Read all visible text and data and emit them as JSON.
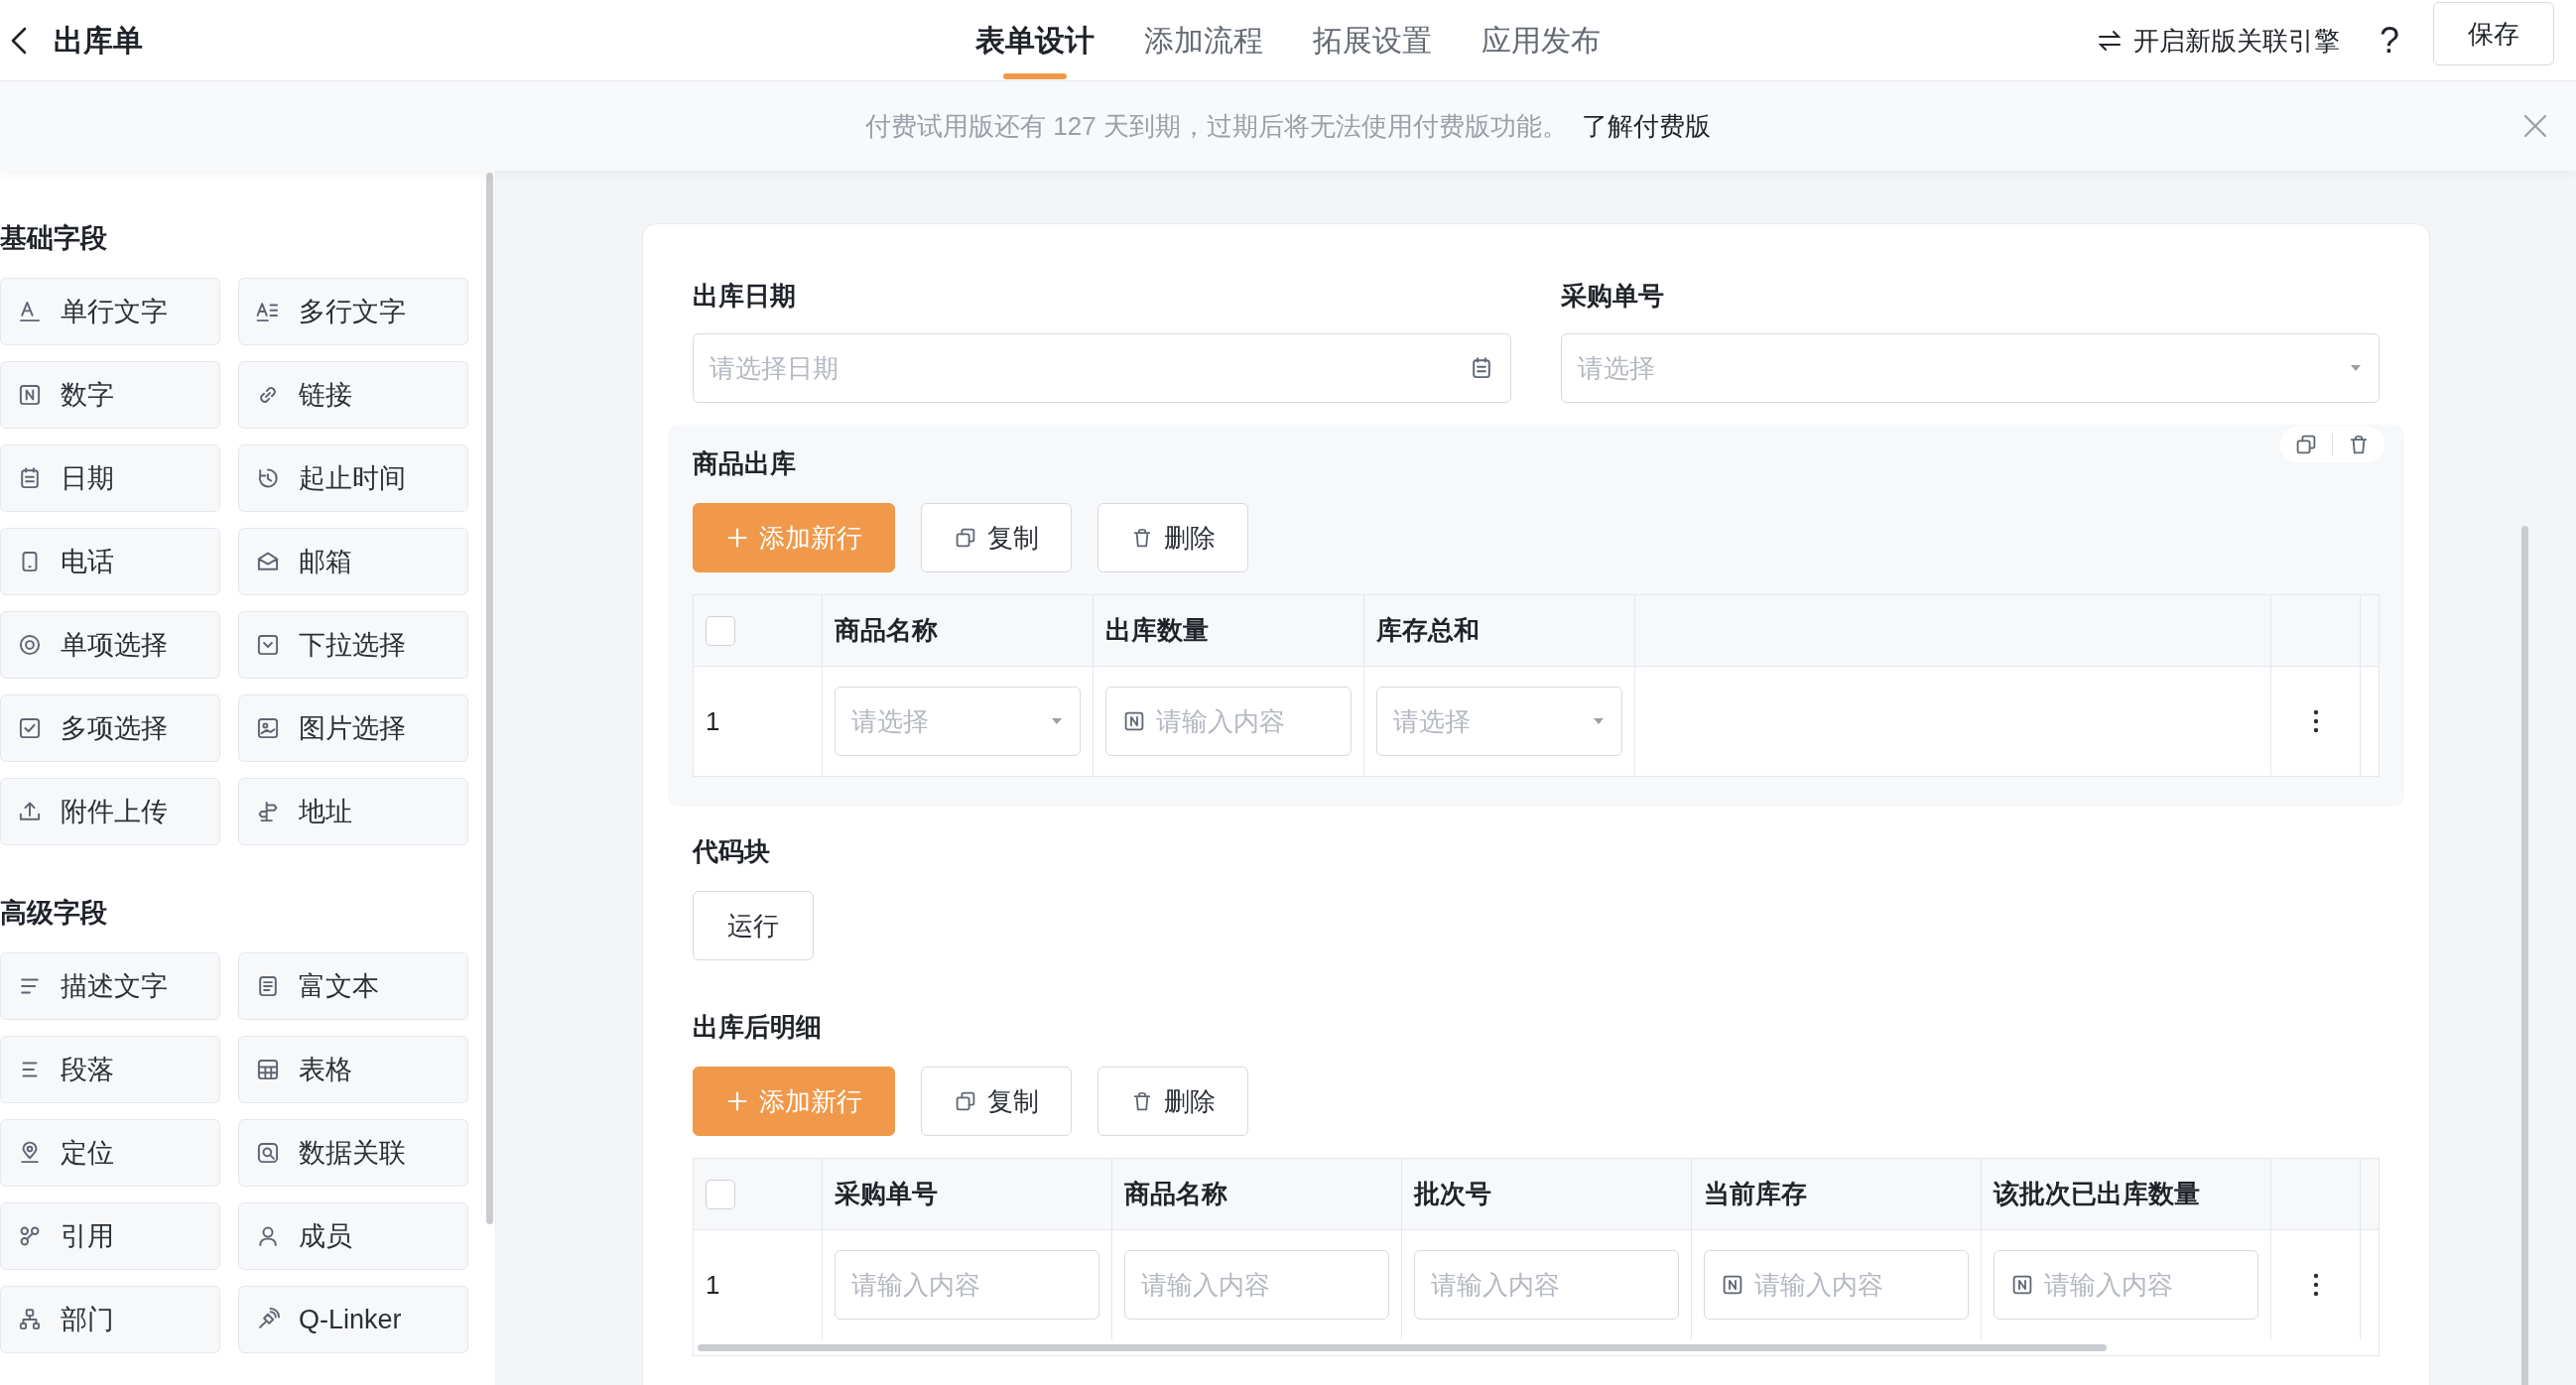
{
  "header": {
    "title": "出库单",
    "tabs": [
      {
        "label": "表单设计",
        "selected": true
      },
      {
        "label": "添加流程",
        "selected": false
      },
      {
        "label": "拓展设置",
        "selected": false
      },
      {
        "label": "应用发布",
        "selected": false
      }
    ],
    "engine_toggle": "开启新版关联引擎",
    "help": "?",
    "save": "保存"
  },
  "banner": {
    "message": "付费试用版还有 127 天到期，过期后将无法使用付费版功能。",
    "link": "了解付费版"
  },
  "sidebar": {
    "sections": [
      {
        "title": "基础字段",
        "items": [
          "单行文字",
          "多行文字",
          "数字",
          "链接",
          "日期",
          "起止时间",
          "电话",
          "邮箱",
          "单项选择",
          "下拉选择",
          "多项选择",
          "图片选择",
          "附件上传",
          "地址"
        ]
      },
      {
        "title": "高级字段",
        "items": [
          "描述文字",
          "富文本",
          "段落",
          "表格",
          "定位",
          "数据关联",
          "引用",
          "成员",
          "部门",
          "Q-Linker"
        ]
      }
    ]
  },
  "form": {
    "sections": [
      {
        "kind": "fields",
        "fields": [
          {
            "label": "出库日期",
            "placeholder": "请选择日期",
            "kind": "date"
          },
          {
            "label": "采购单号",
            "placeholder": "请选择",
            "kind": "select"
          }
        ]
      },
      {
        "kind": "subform",
        "title": "商品出库",
        "selected": true,
        "scrollable": false,
        "select_all_checked": false,
        "actions": [
          {
            "label": "添加新行",
            "kind": "add"
          },
          {
            "label": "复制",
            "kind": "copy"
          },
          {
            "label": "删除",
            "kind": "delete"
          }
        ],
        "columns": [
          "商品名称",
          "出库数量",
          "库存总和"
        ],
        "rows": [
          {
            "number": "1",
            "checked": false,
            "cells": [
              {
                "kind": "select",
                "placeholder": "请选择"
              },
              {
                "kind": "number",
                "placeholder": "请输入内容"
              },
              {
                "kind": "select",
                "placeholder": "请选择"
              }
            ]
          }
        ]
      },
      {
        "kind": "code",
        "title": "代码块",
        "button": "运行"
      },
      {
        "kind": "subform",
        "title": "出库后明细",
        "selected": false,
        "scrollable": true,
        "select_all_checked": false,
        "actions": [
          {
            "label": "添加新行",
            "kind": "add"
          },
          {
            "label": "复制",
            "kind": "copy"
          },
          {
            "label": "删除",
            "kind": "delete"
          }
        ],
        "columns": [
          "采购单号",
          "商品名称",
          "批次号",
          "当前库存",
          "该批次已出库数量"
        ],
        "rows": [
          {
            "number": "1",
            "checked": false,
            "cells": [
              {
                "kind": "text",
                "placeholder": "请输入内容"
              },
              {
                "kind": "text",
                "placeholder": "请输入内容"
              },
              {
                "kind": "text",
                "placeholder": "请输入内容"
              },
              {
                "kind": "number",
                "placeholder": "请输入内容"
              },
              {
                "kind": "number",
                "placeholder": "请输入内容"
              }
            ]
          }
        ]
      }
    ]
  }
}
